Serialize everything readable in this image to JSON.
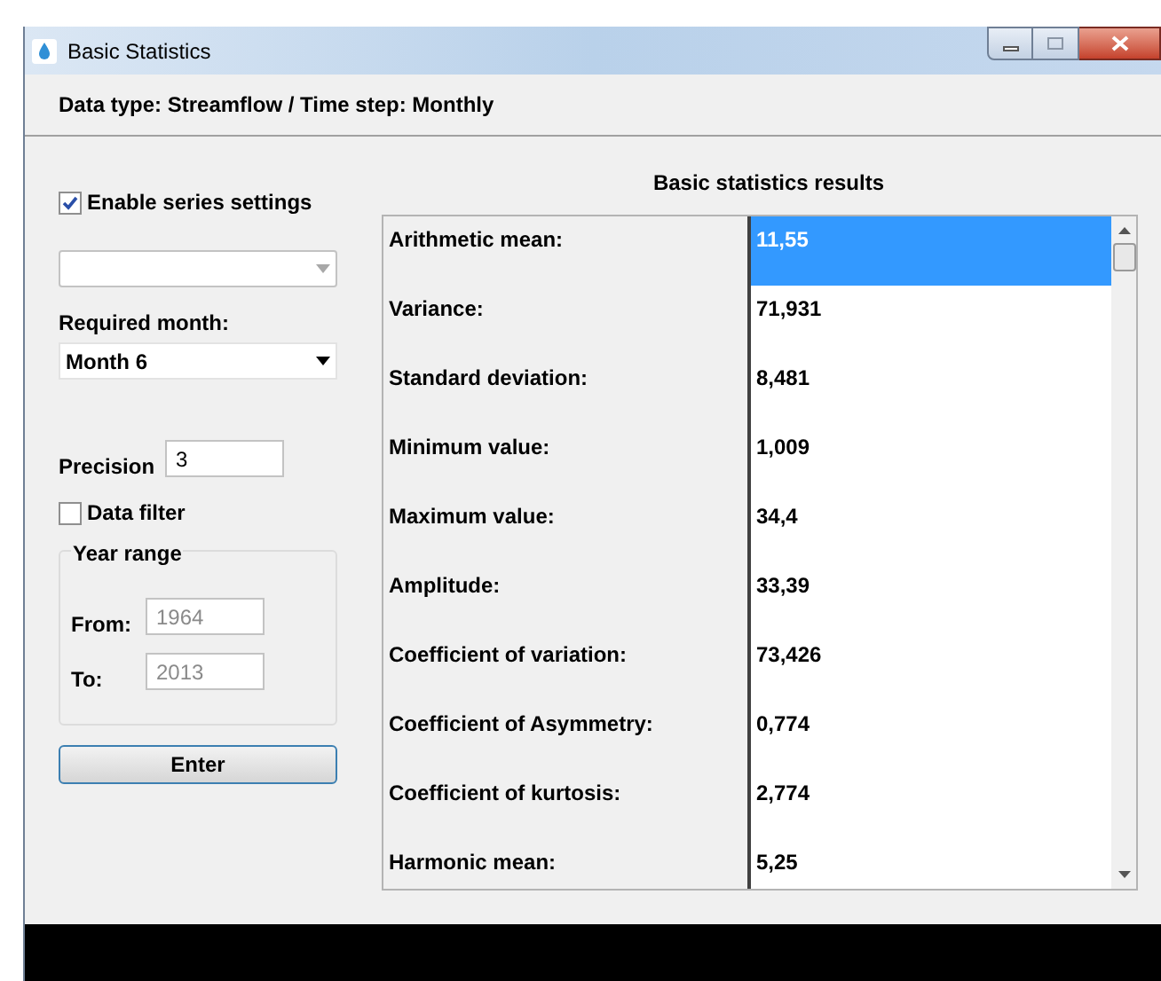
{
  "window": {
    "title": "Basic Statistics"
  },
  "header": "Data type: Streamflow / Time step: Monthly",
  "settings": {
    "enable_series": {
      "label": "Enable series settings",
      "checked": true
    },
    "month": {
      "label": "Required month:",
      "value": "Month 6"
    },
    "precision": {
      "label": "Precision",
      "value": "3"
    },
    "data_filter": {
      "label": "Data filter",
      "checked": false
    },
    "year_range": {
      "title": "Year range",
      "from_label": "From:",
      "from_value": "1964",
      "to_label": "To:",
      "to_value": "2013",
      "disabled": true
    },
    "enter_button": "Enter"
  },
  "results": {
    "title": "Basic statistics results",
    "rows": [
      {
        "label": "Arithmetic mean:",
        "value": "11,55",
        "selected": true
      },
      {
        "label": "Variance:",
        "value": "71,931",
        "selected": false
      },
      {
        "label": "Standard deviation:",
        "value": "8,481",
        "selected": false
      },
      {
        "label": "Minimum value:",
        "value": "1,009",
        "selected": false
      },
      {
        "label": "Maximum value:",
        "value": "34,4",
        "selected": false
      },
      {
        "label": "Amplitude:",
        "value": "33,39",
        "selected": false
      },
      {
        "label": "Coefficient of variation:",
        "value": "73,426",
        "selected": false
      },
      {
        "label": "Coefficient of Asymmetry:",
        "value": "0,774",
        "selected": false
      },
      {
        "label": "Coefficient of kurtosis:",
        "value": "2,774",
        "selected": false
      },
      {
        "label": "Harmonic mean:",
        "value": "5,25",
        "selected": false
      }
    ]
  }
}
